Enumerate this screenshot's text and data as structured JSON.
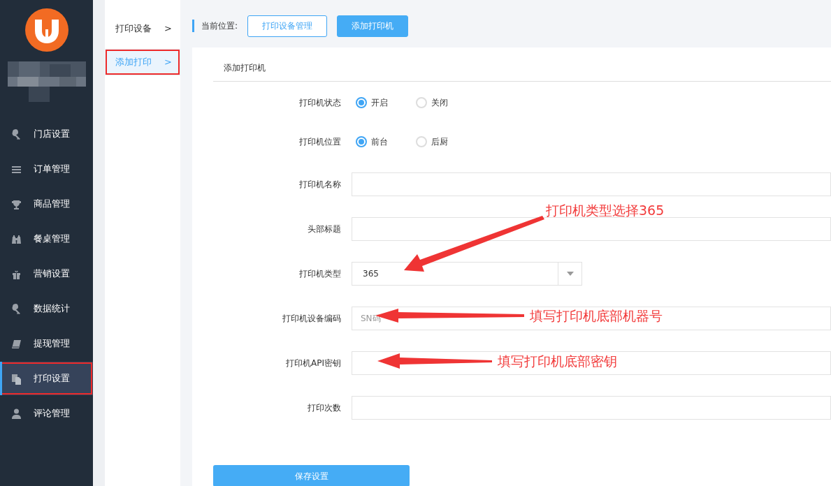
{
  "sidebar": {
    "items": [
      {
        "label": "门店设置",
        "selected": false,
        "highlighted": false
      },
      {
        "label": "订单管理",
        "selected": false,
        "highlighted": false
      },
      {
        "label": "商品管理",
        "selected": false,
        "highlighted": false
      },
      {
        "label": "餐桌管理",
        "selected": false,
        "highlighted": false
      },
      {
        "label": "营销设置",
        "selected": false,
        "highlighted": false
      },
      {
        "label": "数据统计",
        "selected": false,
        "highlighted": false
      },
      {
        "label": "提现管理",
        "selected": false,
        "highlighted": false
      },
      {
        "label": "打印设置",
        "selected": true,
        "highlighted": true
      },
      {
        "label": "评论管理",
        "selected": false,
        "highlighted": false
      }
    ]
  },
  "subnav": {
    "items": [
      {
        "label": "打印设备",
        "chevron": ">",
        "selected": false,
        "highlighted": false
      },
      {
        "label": "添加打印",
        "chevron": ">",
        "selected": true,
        "highlighted": true
      }
    ]
  },
  "breadcrumb": {
    "label": "当前位置:",
    "buttons": [
      {
        "label": "打印设备管理",
        "selected": false
      },
      {
        "label": "添加打印机",
        "selected": true
      }
    ]
  },
  "form": {
    "title": "添加打印机",
    "fields": [
      {
        "kind": "radio",
        "label": "打印机状态",
        "options": [
          {
            "label": "开启",
            "selected": true
          },
          {
            "label": "关闭",
            "selected": false
          }
        ]
      },
      {
        "kind": "radio",
        "label": "打印机位置",
        "options": [
          {
            "label": "前台",
            "selected": true
          },
          {
            "label": "后厨",
            "selected": false
          }
        ]
      },
      {
        "kind": "text",
        "label": "打印机名称"
      },
      {
        "kind": "text",
        "label": "头部标题"
      },
      {
        "kind": "select",
        "label": "打印机类型",
        "value": "365"
      },
      {
        "kind": "text",
        "label": "打印机设备编码",
        "placeholder": "SN码"
      },
      {
        "kind": "text",
        "label": "打印机API密钥"
      },
      {
        "kind": "text",
        "label": "打印次数"
      }
    ],
    "save_button": "保存设置"
  },
  "annotations": [
    {
      "text": "打印机类型选择365"
    },
    {
      "text": "填写打印机底部机器号"
    },
    {
      "text": "填写打印机底部密钥"
    }
  ]
}
